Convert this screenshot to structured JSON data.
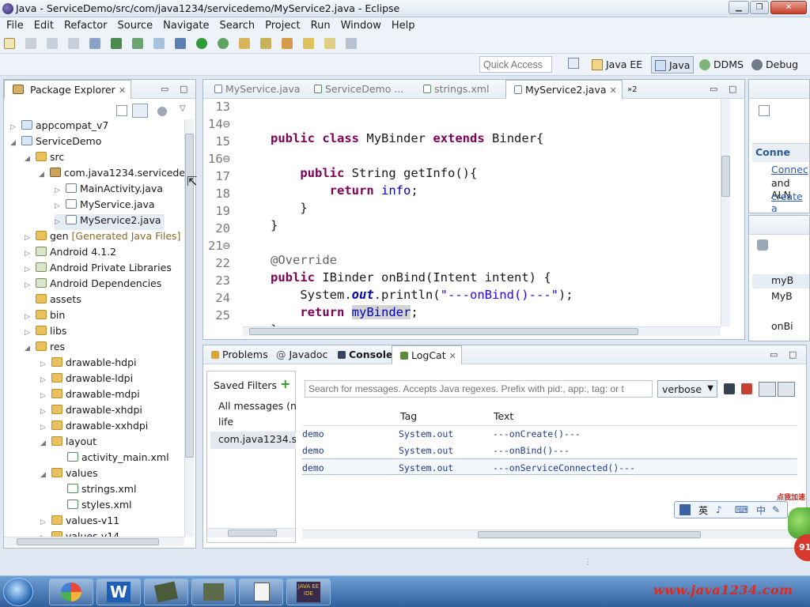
{
  "window": {
    "title": "Java - ServiceDemo/src/com/java1234/servicedemo/MyService2.java - Eclipse"
  },
  "menu": [
    "File",
    "Edit",
    "Refactor",
    "Source",
    "Navigate",
    "Search",
    "Project",
    "Run",
    "Window",
    "Help"
  ],
  "quick_access": {
    "placeholder": "Quick Access"
  },
  "perspectives": [
    "Java EE",
    "Java",
    "DDMS",
    "Debug"
  ],
  "package_explorer": {
    "title": "Package Explorer",
    "items": [
      "appcompat_v7",
      "ServiceDemo",
      "src",
      "com.java1234.serviceden",
      "MainActivity.java",
      "MyService.java",
      "MyService2.java",
      "gen",
      "[Generated Java Files]",
      "Android 4.1.2",
      "Android Private Libraries",
      "Android Dependencies",
      "assets",
      "bin",
      "libs",
      "res",
      "drawable-hdpi",
      "drawable-ldpi",
      "drawable-mdpi",
      "drawable-xhdpi",
      "drawable-xxhdpi",
      "layout",
      "activity_main.xml",
      "values",
      "strings.xml",
      "styles.xml",
      "values-v11",
      "values-v14"
    ]
  },
  "editor": {
    "tabs": [
      "MyService.java",
      "ServiceDemo ...",
      "strings.xml",
      "MyService2.java",
      "»2"
    ],
    "lines": [
      {
        "n": "13",
        "t": ""
      },
      {
        "n": "14⊖",
        "t": "public class MyBinder extends Binder{"
      },
      {
        "n": "15",
        "t": ""
      },
      {
        "n": "16⊖",
        "t": "    public String getInfo(){"
      },
      {
        "n": "17",
        "t": "        return info;"
      },
      {
        "n": "18",
        "t": "    }"
      },
      {
        "n": "19",
        "t": "}"
      },
      {
        "n": "20",
        "t": ""
      },
      {
        "n": "21⊖",
        "t": "@Override"
      },
      {
        "n": "22",
        "t": "public IBinder onBind(Intent intent) {"
      },
      {
        "n": "23",
        "t": "    System.out.println(\"---onBind()---\");"
      },
      {
        "n": "24",
        "t": "    return myBinder;"
      },
      {
        "n": "25",
        "t": "}"
      }
    ],
    "tokens": {
      "public": "public",
      "class": "class",
      "MyBinder": "MyBinder",
      "extends": "extends",
      "Binder": "Binder{",
      "String": "String",
      "getInfo": "getInfo(){",
      "return": "return",
      "info": "info",
      "semi": ";",
      "rbrace": "}",
      "override": "@Override",
      "IBinder": "IBinder",
      "onBind": "onBind(Intent intent) {",
      "System": "System.",
      "out": "out",
      "println": ".println(",
      "onbind_str": "\"---onBind()---\"",
      "close_call": ");",
      "myBinder": "myBinder"
    }
  },
  "right_panels": {
    "connect_title": "Conne",
    "connect_link1": "Connec",
    "connect_text": "and ALN",
    "connect_link2": "create a",
    "outline_item1": "myB",
    "outline_item2": "MyB",
    "outline_item3": "onBi"
  },
  "bottom": {
    "tabs": [
      "Problems",
      "Javadoc",
      "Console",
      "LogCat"
    ],
    "saved_filters_label": "Saved Filters",
    "filters": [
      "All messages (nc",
      "life",
      "com.java1234.ser"
    ],
    "search": {
      "placeholder": "Search for messages. Accepts Java regexes. Prefix with pid:, app:, tag: or t"
    },
    "level": "verbose",
    "columns": {
      "tag": "Tag",
      "text": "Text"
    },
    "rows": [
      {
        "app": "demo",
        "tag": "System.out",
        "text": "---onCreate()---"
      },
      {
        "app": "demo",
        "tag": "System.out",
        "text": "---onBind()---"
      },
      {
        "app": "demo",
        "tag": "System.out",
        "text": "---onServiceConnected()---"
      }
    ]
  },
  "overlay": {
    "ime": [
      "英",
      "♪",
      "⌨",
      "中"
    ],
    "badge": "91",
    "promo": "点我加速",
    "watermark": "www.java1234.com"
  },
  "taskbar": {
    "eclipse_label": "JAVA EE IDE"
  },
  "colors": {
    "keyword": "#7f0055",
    "field": "#0000c0",
    "string": "#2a00ff",
    "annotation": "#646464",
    "logcat_text": "#1e3c92"
  }
}
